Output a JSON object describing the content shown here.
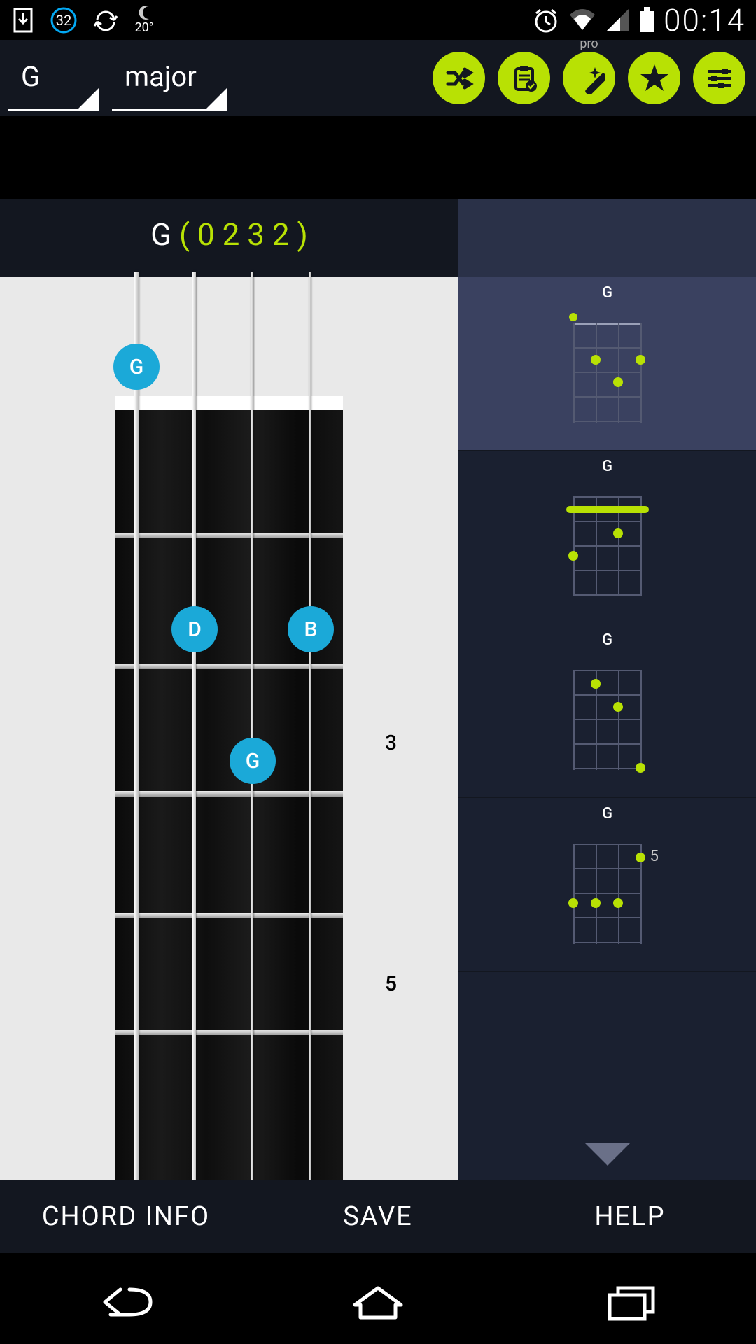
{
  "status": {
    "temperature": "20°",
    "date_badge": "32",
    "time": "00:14"
  },
  "topbar": {
    "note": "G",
    "type": "major",
    "pro_label": "pro"
  },
  "chord": {
    "root": "G",
    "pattern": "( 0 2 3 2 )",
    "fingers": [
      {
        "label": "G",
        "string": 1,
        "fret": 0
      },
      {
        "label": "D",
        "string": 2,
        "fret": 2
      },
      {
        "label": "G",
        "string": 3,
        "fret": 3
      },
      {
        "label": "B",
        "string": 4,
        "fret": 2
      }
    ],
    "fret_markers": [
      {
        "num": "3",
        "fret": 3
      },
      {
        "num": "5",
        "fret": 5
      }
    ]
  },
  "variants": [
    {
      "label": "G",
      "open_strings": [
        1
      ],
      "dots": [
        [
          2,
          2
        ],
        [
          3,
          3
        ],
        [
          4,
          2
        ]
      ],
      "selected": true
    },
    {
      "label": "G",
      "barre_fret": 1,
      "dots": [
        [
          3,
          2
        ],
        [
          1,
          3
        ]
      ],
      "selected": false
    },
    {
      "label": "G",
      "dots": [
        [
          2,
          1
        ],
        [
          3,
          2
        ],
        [
          4,
          4
        ]
      ],
      "selected": false
    },
    {
      "label": "G",
      "fret_offset": "5",
      "dots": [
        [
          4,
          1
        ],
        [
          1,
          3
        ],
        [
          2,
          3
        ],
        [
          3,
          3
        ]
      ],
      "selected": false
    }
  ],
  "actions": {
    "chord_info": "CHORD INFO",
    "save": "SAVE",
    "help": "HELP"
  }
}
